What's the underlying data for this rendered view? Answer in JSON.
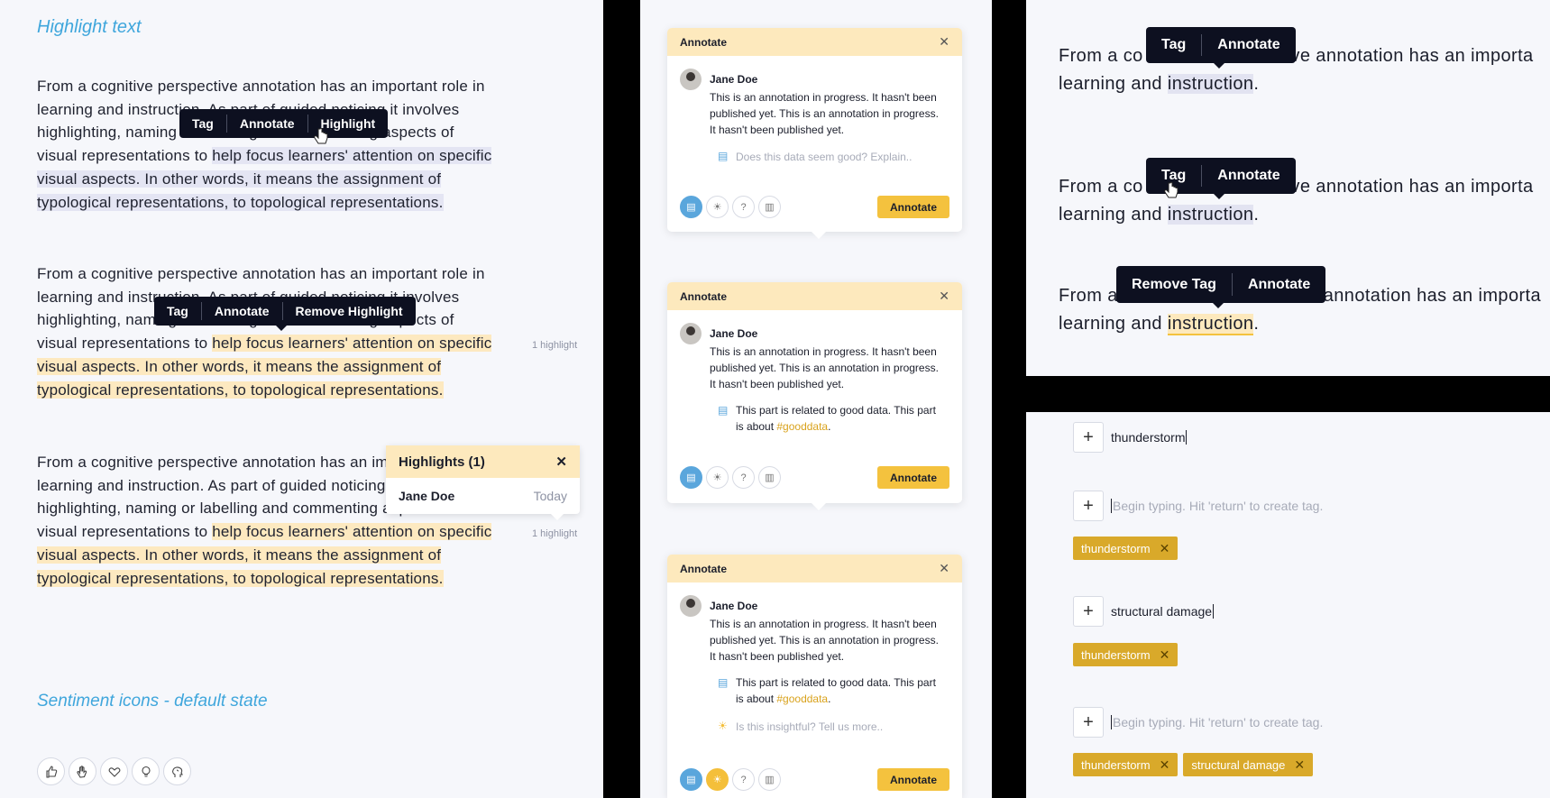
{
  "left": {
    "title_highlight": "Highlight text",
    "para_lines": {
      "l1": "From a cognitive perspective annotation has an important role in",
      "l2": "learning and instruction. As part of guided noticing it involves",
      "l3": "highlighting, naming or labelling and commenting aspects of",
      "l4a": "visual representations to ",
      "l4b": "help focus learners' attention on specific",
      "l5": "visual aspects. In other words, it means the assignment of",
      "l6": "typological representations, to topological representations."
    },
    "menu1": {
      "tag": "Tag",
      "annotate": "Annotate",
      "highlight": "Highlight"
    },
    "menu2": {
      "tag": "Tag",
      "annotate": "Annotate",
      "remove": "Remove Highlight"
    },
    "highlight_count": "1 highlight",
    "highlights_popup": {
      "title": "Highlights (1)",
      "user": "Jane Doe",
      "date": "Today"
    },
    "title_sentiment": "Sentiment icons - default state",
    "sentiment_icons": [
      "thumbs-up-icon",
      "clap-icon",
      "heart-icon",
      "lightbulb-icon",
      "brain-icon"
    ]
  },
  "middle": {
    "header": "Annotate",
    "user": "Jane Doe",
    "body": "This is an annotation in progress. It hasn't been published yet. This is an annotation in progress. It hasn't been published yet.",
    "placeholder_data": "Does this data seem good? Explain..",
    "data_text": "This part is related to good data. This part is about ",
    "tag": "#gooddata",
    "tag_after": ".",
    "placeholder_insight": "Is this insightful? Tell us more..",
    "button": "Annotate"
  },
  "right_top": {
    "line1a": "From a co",
    "line1b": "tive annotation has an importa",
    "line2a": "learning and ",
    "line2b": "instruction",
    "line2c": ".",
    "line3a": "From a",
    "line3b": "annotation has an importa",
    "menuA": {
      "tag": "Tag",
      "annotate": "Annotate"
    },
    "menuC": {
      "remove": "Remove Tag",
      "annotate": "Annotate"
    }
  },
  "right_bottom": {
    "input1": "thunderstorm",
    "placeholder": "Begin typing. Hit 'return' to create tag.",
    "chip1": "thunderstorm",
    "input2": "structural damage",
    "chip2": "structural damage",
    "plus": "+",
    "remove": "✕"
  },
  "colors": {
    "accent_blue": "#3fa6dc",
    "highlight_yellow": "#fde9bd",
    "button_yellow": "#f4c23e",
    "chip_gold": "#d9a92a",
    "tooltip_dark": "#0d1020"
  }
}
